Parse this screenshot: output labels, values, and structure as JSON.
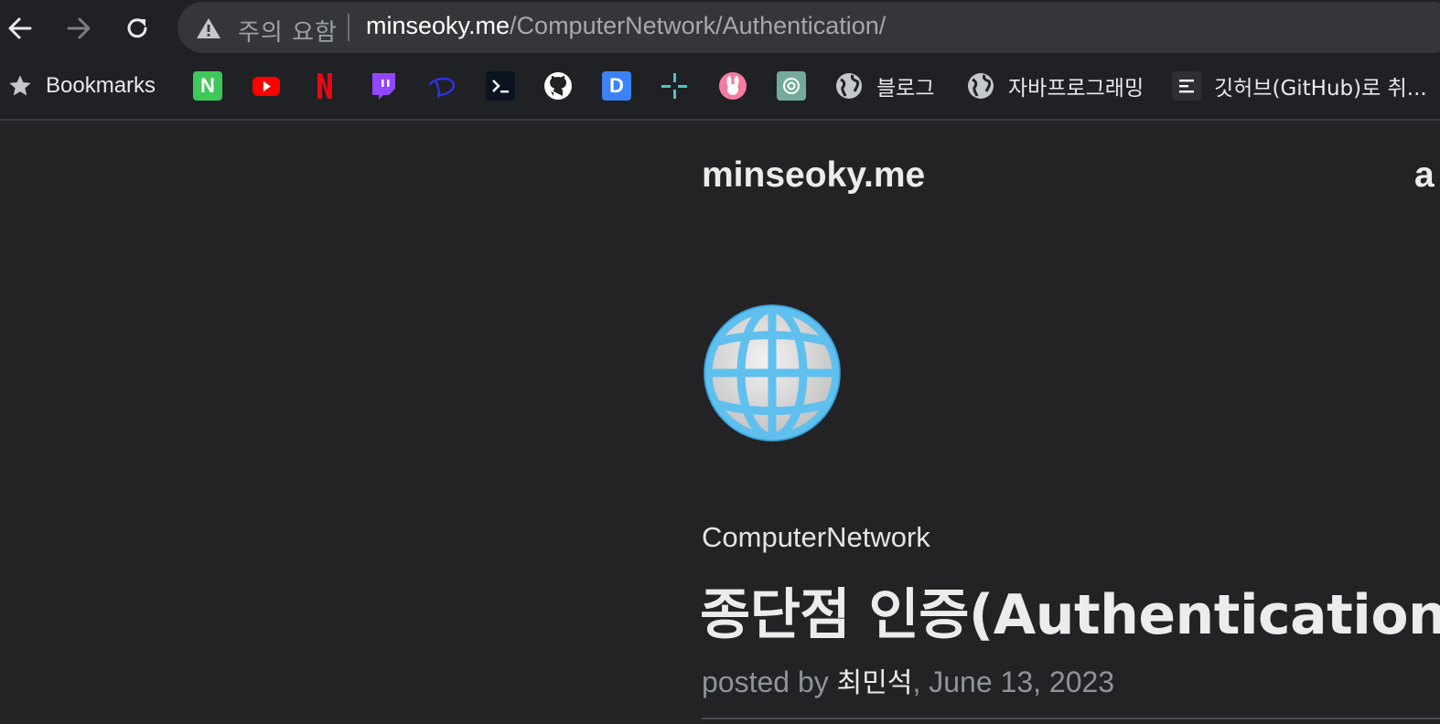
{
  "browser": {
    "security_label": "주의 요함",
    "url_host": "minseoky.me",
    "url_path": "/ComputerNetwork/Authentication/",
    "nav_icons": [
      "back-arrow-icon",
      "forward-arrow-icon",
      "reload-icon"
    ]
  },
  "bookmarks": {
    "folder_label": "Bookmarks",
    "items": [
      {
        "icon": "naver-icon"
      },
      {
        "icon": "youtube-icon"
      },
      {
        "icon": "netflix-icon"
      },
      {
        "icon": "twitch-icon"
      },
      {
        "icon": "disney-plus-icon"
      },
      {
        "icon": "terminal-icon"
      },
      {
        "icon": "github-icon"
      },
      {
        "icon": "dp-icon"
      },
      {
        "icon": "slack-like-icon"
      },
      {
        "icon": "rabbit-icon"
      },
      {
        "icon": "chatgpt-icon"
      },
      {
        "icon": "globe-icon",
        "label": "블로그"
      },
      {
        "icon": "globe-icon",
        "label": "자바프로그래밍"
      },
      {
        "icon": "document-icon",
        "label": "깃허브(GitHub)로 취..."
      }
    ]
  },
  "page": {
    "site_title": "minseoky.me",
    "nav_peek": "a",
    "category": "ComputerNetwork",
    "title": "종단점 인증(Authentication)",
    "posted_by_prefix": "posted by ",
    "author": "최민석",
    "date": ", June 13, 2023"
  },
  "colors": {
    "background": "#232325",
    "toolbar": "#202124",
    "omnibox": "#35363a",
    "muted_text": "#8e939c"
  }
}
